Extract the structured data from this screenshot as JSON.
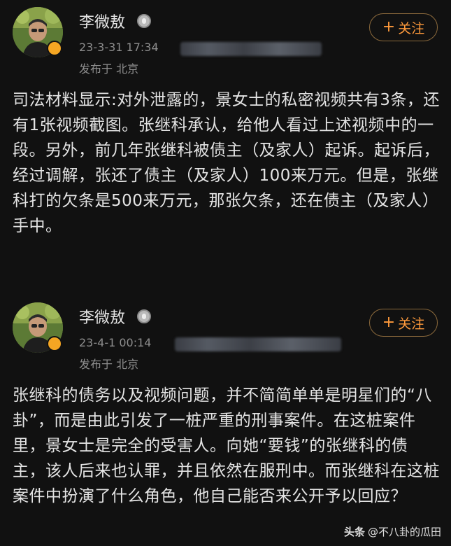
{
  "posts": [
    {
      "author": "李微敖",
      "follow_label": "关注",
      "timestamp": "23-3-31 17:34",
      "location": "发布于 北京",
      "text": "司法材料显示:对外泄露的，景女士的私密视频共有3条，还有1张视频截图。张继科承认，给他人看过上述视频中的一段。另外，前几年张继科被债主（及家人）起诉。起诉后，经过调解，张还了债主（及家人）100来万元。但是，张继科打的欠条是500来万元，那张欠条，还在债主（及家人）手中。"
    },
    {
      "author": "李微敖",
      "follow_label": "关注",
      "timestamp": "23-4-1 00:14",
      "location": "发布于 北京",
      "text": "张继科的债务以及视频问题，并不简简单单是明星们的“八卦”，而是由此引发了一桩严重的刑事案件。在这桩案件里，景女士是完全的受害人。向她“要钱”的张继科的债主，该人后来也认罪，并且依然在服刑中。而张继科在这桩案件中扮演了什么角色，他自己能否来公开予以回应？"
    }
  ],
  "watermark": {
    "brand": "头条",
    "handle": "@不八卦的瓜田"
  },
  "colors": {
    "background": "#111111",
    "follow_accent": "#ff9a3c",
    "verified_badge": "#f5a623"
  },
  "icons": {
    "verified": "verified-badge-icon",
    "medal": "medal-icon",
    "plus": "plus-icon"
  }
}
